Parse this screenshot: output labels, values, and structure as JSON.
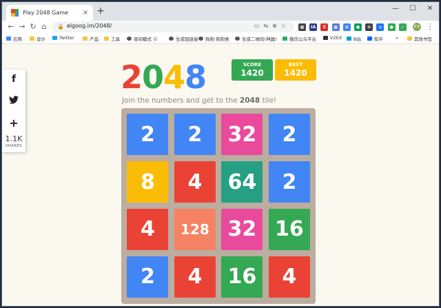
{
  "browser": {
    "tab_title": "Play 2048 Game",
    "tab_close": "×",
    "new_tab": "+",
    "minimize": "—",
    "maximize": "☐",
    "close": "✕",
    "url": "elgoog.im/2048/",
    "back": "←",
    "forward": "→",
    "reload": "↻",
    "home": "⌂",
    "profile_label": "安全"
  },
  "extensions": [
    {
      "icon": "tab-search-icon",
      "color": "#444444",
      "label": "▦"
    },
    {
      "icon": "ia-icon",
      "color": "#2f3c8f",
      "label": "IA"
    },
    {
      "icon": "ext-red-icon",
      "color": "#d93025",
      "label": "C"
    },
    {
      "icon": "ext-grid-icon",
      "color": "#5b7bd5",
      "label": "▦"
    },
    {
      "icon": "ext-blue-icon",
      "color": "#4285f4",
      "label": "≡"
    },
    {
      "icon": "ext-green-icon",
      "color": "#0f9d58",
      "label": "●"
    },
    {
      "icon": "ext-dark-icon",
      "color": "#3c4043",
      "label": "⊙"
    },
    {
      "icon": "ext-navy-icon",
      "color": "#1a73e8",
      "label": "◎"
    },
    {
      "icon": "ext-lime-icon",
      "color": "#34a853",
      "label": "●"
    },
    {
      "icon": "ext-check-icon",
      "color": "#34a853",
      "label": "✓"
    }
  ],
  "bookmarks": [
    {
      "label": "应用",
      "icon": "apps-grid-icon",
      "color": "#4285f4"
    },
    {
      "label": "设计",
      "icon": "folder-icon",
      "color": "#f5c542"
    },
    {
      "label": "Twitter",
      "icon": "twitter-icon",
      "color": "#1da1f2"
    },
    {
      "label": "产品",
      "icon": "folder-icon",
      "color": "#f5c542"
    },
    {
      "label": "工具",
      "icon": "folder-icon",
      "color": "#f5c542"
    },
    {
      "label": "夜间模式 ⓪",
      "icon": "globe-icon",
      "color": "#555555"
    },
    {
      "label": "生成短链接",
      "icon": "globe-icon",
      "color": "#555555"
    },
    {
      "label": "狗狗·狗狗党",
      "icon": "globe-icon",
      "color": "#555555"
    },
    {
      "label": "生成二维码(神器)",
      "icon": "globe-icon",
      "color": "#555555"
    },
    {
      "label": "微信公众平台",
      "icon": "wechat-icon",
      "color": "#2aae67"
    },
    {
      "label": "V2EX",
      "icon": "v2ex-icon",
      "color": "#333333"
    },
    {
      "label": "B站",
      "icon": "bilibili-icon",
      "color": "#00a1d6"
    },
    {
      "label": "知乎",
      "icon": "zhihu-icon",
      "color": "#0066ff"
    },
    {
      "label": "»",
      "icon": "",
      "color": ""
    },
    {
      "label": "其他书签",
      "icon": "folder-icon",
      "color": "#f5c542"
    }
  ],
  "share": {
    "facebook": "f",
    "twitter": "🐦",
    "plus": "+",
    "count": "1.1K",
    "label": "SHARES"
  },
  "game": {
    "logo": [
      {
        "char": "2",
        "color": "#ea4335"
      },
      {
        "char": "0",
        "color": "#34a853"
      },
      {
        "char": "4",
        "color": "#fbbc05"
      },
      {
        "char": "8",
        "color": "#4285f4"
      }
    ],
    "score_label": "SCORE",
    "score": "1420",
    "best_label": "BEST",
    "best": "1420",
    "score_color": "#34a853",
    "best_color": "#fbbc05",
    "intro_prefix": "Join the numbers and get to the ",
    "intro_bold": "2048",
    "intro_suffix": " tile!",
    "board_color": "#bbada0",
    "tiles": [
      [
        "2",
        "2",
        "32",
        "2"
      ],
      [
        "8",
        "4",
        "64",
        "2"
      ],
      [
        "4",
        "128",
        "32",
        "16"
      ],
      [
        "2",
        "4",
        "16",
        "4"
      ]
    ],
    "tile_colors": {
      "2": "#4285f4",
      "4": "#ea4335",
      "8": "#fbbc05",
      "16": "#34a853",
      "32": "#e94a9c",
      "64": "#25a082",
      "128": "#f58262"
    }
  }
}
